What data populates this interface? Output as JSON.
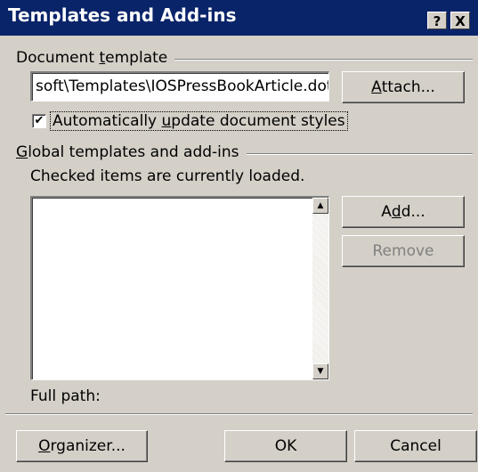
{
  "window": {
    "title": "Templates and Add-ins",
    "help_button": "?",
    "close_button": "X"
  },
  "document_template": {
    "group_label_pre": "Document ",
    "group_label_accel": "t",
    "group_label_post": "emplate",
    "path_value": "soft\\Templates\\IOSPressBookArticle.dot",
    "attach_accel": "A",
    "attach_rest": "ttach..."
  },
  "auto_update": {
    "checked": true,
    "check_glyph": "✔",
    "label_pre": "Automatically ",
    "label_accel": "u",
    "label_post": "pdate document styles"
  },
  "global": {
    "group_label_accel": "G",
    "group_label_post": "lobal templates and add-ins",
    "hint": "Checked items are currently loaded.",
    "items": [],
    "add_pre": "A",
    "add_accel": "d",
    "add_post": "d...",
    "remove_label": "Remove",
    "full_path_label": "Full path:"
  },
  "footer": {
    "organizer_accel": "O",
    "organizer_rest": "rganizer...",
    "ok_label": "OK",
    "cancel_label": "Cancel"
  }
}
